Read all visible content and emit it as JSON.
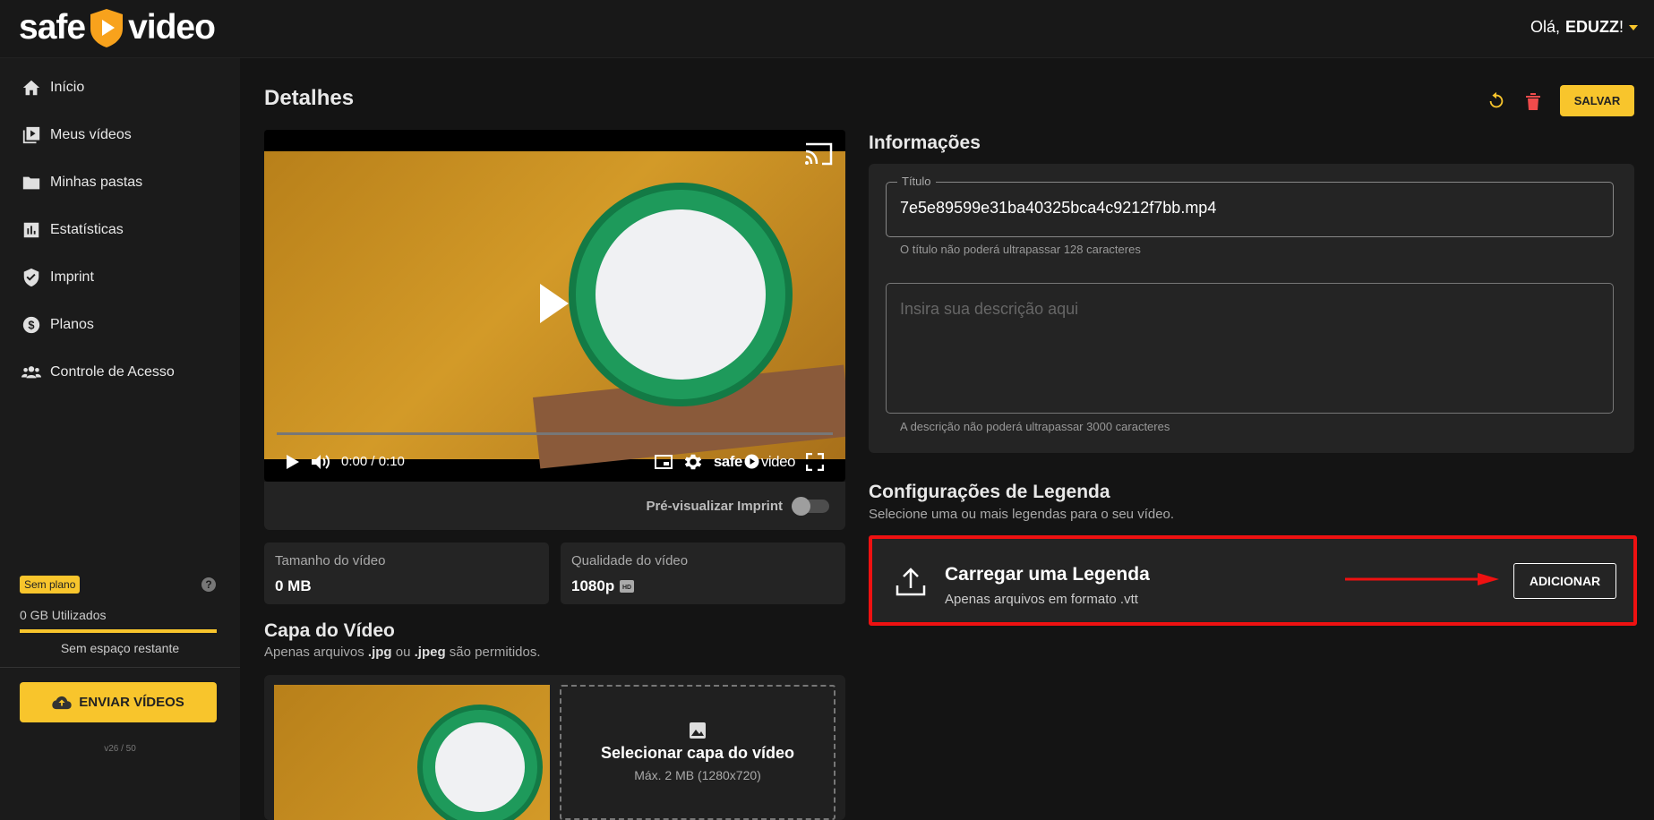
{
  "brand": {
    "left": "safe",
    "right": "video",
    "accent": "#f8c52c"
  },
  "user": {
    "greeting": "Olá,",
    "name": "EDUZZ",
    "suffix": "!"
  },
  "sidebar": {
    "items": [
      {
        "label": "Início",
        "icon": "home-icon"
      },
      {
        "label": "Meus vídeos",
        "icon": "video-library-icon"
      },
      {
        "label": "Minhas pastas",
        "icon": "folder-icon"
      },
      {
        "label": "Estatísticas",
        "icon": "bar-chart-icon"
      },
      {
        "label": "Imprint",
        "icon": "shield-check-icon"
      },
      {
        "label": "Planos",
        "icon": "dollar-circle-icon"
      },
      {
        "label": "Controle de Acesso",
        "icon": "people-icon"
      }
    ],
    "plan_badge": "Sem plano",
    "used": "0 GB Utilizados",
    "usage_fraction": 0,
    "free": "Sem espaço restante",
    "send_label": "ENVIAR VÍDEOS",
    "version": "v26 / 50"
  },
  "page": {
    "title": "Detalhes",
    "save_label": "SALVAR"
  },
  "player": {
    "time": "0:00 / 0:10",
    "brand_left": "safe",
    "brand_right": "video",
    "progress": 0
  },
  "preview": {
    "label": "Pré-visualizar Imprint",
    "on": false
  },
  "stats": {
    "size_label": "Tamanho do vídeo",
    "size_value": "0 MB",
    "quality_label": "Qualidade do vídeo",
    "quality_value": "1080p"
  },
  "cover": {
    "title": "Capa do Vídeo",
    "sub_a": "Apenas arquivos ",
    "sub_jpg": ".jpg",
    "sub_or": " ou ",
    "sub_jpeg": ".jpeg",
    "sub_b": " são permitidos.",
    "select_title": "Selecionar capa do vídeo",
    "select_sub": "Máx. 2 MB (1280x720)"
  },
  "info": {
    "title": "Informações",
    "title_field_label": "Título",
    "title_value": "7e5e89599e31ba40325bca4c9212f7bb.mp4",
    "title_help": "O título não poderá ultrapassar 128 caracteres",
    "desc_placeholder": "Insira sua descrição aqui",
    "desc_help": "A descrição não poderá ultrapassar 3000 caracteres"
  },
  "subtitles": {
    "title": "Configurações de Legenda",
    "sub": "Selecione uma ou mais legendas para o seu vídeo.",
    "upload_title": "Carregar uma Legenda",
    "upload_sub": "Apenas arquivos em formato .vtt",
    "add_label": "ADICIONAR",
    "highlight_color": "#e11111"
  }
}
